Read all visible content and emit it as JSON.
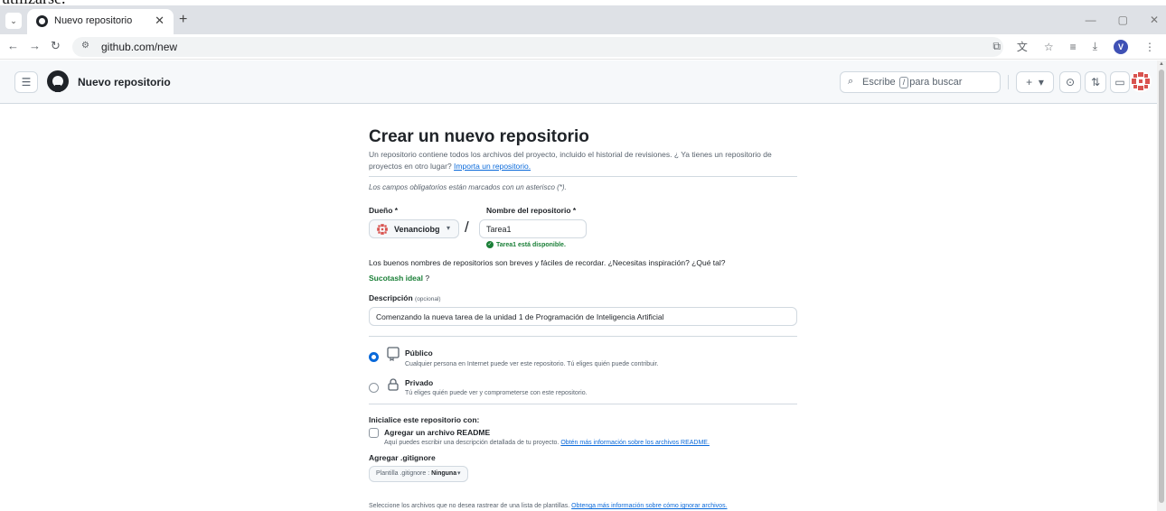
{
  "browser": {
    "tab_title": "Nuevo repositorio",
    "url": "github.com/new"
  },
  "header": {
    "title": "Nuevo repositorio",
    "search_prefix": "Escribe",
    "search_key": "/",
    "search_suffix": "para buscar"
  },
  "form": {
    "page_title": "Crear un nuevo repositorio",
    "intro_text": "Un repositorio contiene todos los archivos del proyecto, incluido el historial de revisiones. ¿ Ya tienes un repositorio de proyectos en otro lugar?",
    "import_link": "Importa un repositorio.",
    "required_note": "Los campos obligatorios están marcados con un asterisco (*).",
    "owner_label": "Dueño *",
    "owner_value": "Venanciobg",
    "repo_name_label": "Nombre del repositorio *",
    "repo_name_value": "Tarea1",
    "availability": "Tarea1 está disponible.",
    "suggestion_text": "Los buenos nombres de repositorios son breves y fáciles de recordar. ¿Necesitas inspiración? ¿Qué tal?",
    "suggestion_name": "Sucotash ideal",
    "suggestion_mark": "?",
    "description_label": "Descripción",
    "description_optional": "(opcional)",
    "description_value": "Comenzando la nueva tarea de la unidad 1 de Programación de Inteligencia Artificial",
    "public_title": "Público",
    "public_desc": "Cualquier persona en Internet puede ver este repositorio. Tú eliges quién puede contribuir.",
    "private_title": "Privado",
    "private_desc": "Tú eliges quién puede ver y comprometerse con este repositorio.",
    "init_title": "Inicialice este repositorio con:",
    "readme_title": "Agregar un archivo README",
    "readme_desc": "Aquí puedes escribir una descripción detallada de tu proyecto.",
    "readme_link": "Obtén más información sobre los archivos README.",
    "gitignore_title": "Agregar .gitignore",
    "gitignore_prefix": "Plantilla .gitignore :",
    "gitignore_value": "Ninguna",
    "gitignore_help": "Seleccione los archivos que no desea rastrear de una lista de plantillas.",
    "gitignore_link": "Obtenga más información sobre cómo ignorar archivos."
  },
  "colors": {
    "accent": "#0969da",
    "success": "#1a7f37"
  }
}
